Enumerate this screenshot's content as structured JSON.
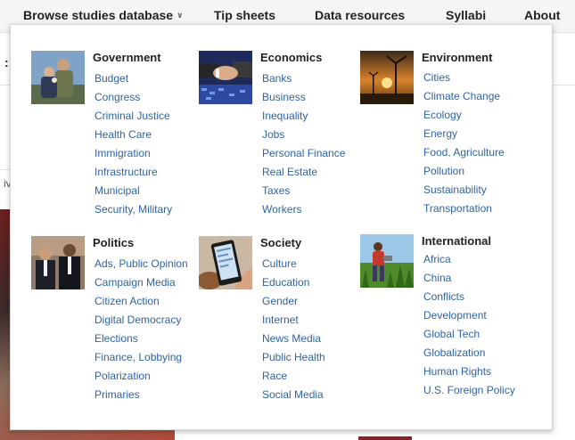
{
  "nav": {
    "items": [
      {
        "label": "Browse studies database",
        "has_chevron": true
      },
      {
        "label": "Tip sheets"
      },
      {
        "label": "Data resources"
      },
      {
        "label": "Syllabi"
      },
      {
        "label": "About"
      }
    ],
    "chevron_icon": "chevron-down-double-icon"
  },
  "background": {
    "colon_text": ":",
    "partial_text": "iv"
  },
  "sections": {
    "government": {
      "title": "Government",
      "thumb_icon": "soldier-family-photo",
      "links": [
        "Budget",
        "Congress",
        "Criminal Justice",
        "Health Care",
        "Immigration",
        "Infrastructure",
        "Municipal",
        "Security, Military"
      ]
    },
    "economics": {
      "title": "Economics",
      "thumb_icon": "handshake-photo",
      "links": [
        "Banks",
        "Business",
        "Inequality",
        "Jobs",
        "Personal Finance",
        "Real Estate",
        "Taxes",
        "Workers"
      ]
    },
    "environment": {
      "title": "Environment",
      "thumb_icon": "wind-turbine-photo",
      "links": [
        "Cities",
        "Climate Change",
        "Ecology",
        "Energy",
        "Food, Agriculture",
        "Pollution",
        "Sustainability",
        "Transportation"
      ]
    },
    "politics": {
      "title": "Politics",
      "thumb_icon": "politicians-photo",
      "links": [
        "Ads, Public Opinion",
        "Campaign Media",
        "Citizen Action",
        "Digital Democracy",
        "Elections",
        "Finance, Lobbying",
        "Polarization",
        "Primaries"
      ]
    },
    "society": {
      "title": "Society",
      "thumb_icon": "smartphone-photo",
      "links": [
        "Culture",
        "Education",
        "Gender",
        "Internet",
        "News Media",
        "Public Health",
        "Race",
        "Social Media"
      ]
    },
    "international": {
      "title": "International",
      "thumb_icon": "farmer-field-photo",
      "links": [
        "Africa",
        "China",
        "Conflicts",
        "Development",
        "Global Tech",
        "Globalization",
        "Human Rights",
        "U.S. Foreign Policy"
      ]
    }
  },
  "colors": {
    "link": "#2f63a3",
    "heading": "#222222",
    "nav_bg": "#f5f5f5"
  }
}
